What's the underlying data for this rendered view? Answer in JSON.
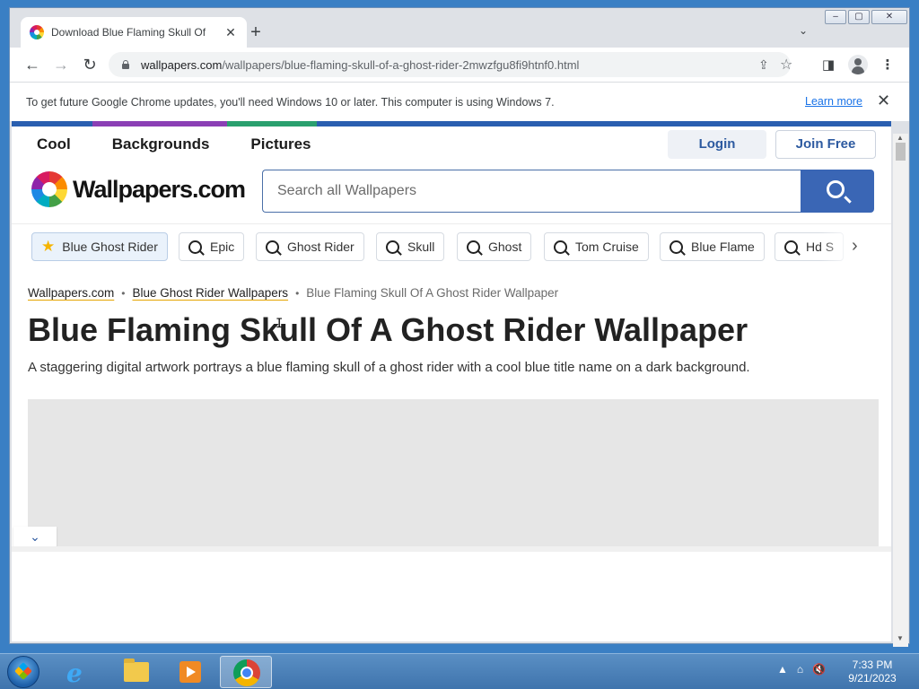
{
  "browser": {
    "tab_title": "Download Blue Flaming Skull Of",
    "tab_close": "✕",
    "new_tab": "+",
    "tab_search": "⌄",
    "window_controls": {
      "minimize": "–",
      "maximize": "▢",
      "close": "✕"
    },
    "nav": {
      "back": "←",
      "forward": "→",
      "reload": "↻"
    },
    "url_domain": "wallpapers.com",
    "url_path": "/wallpapers/blue-flaming-skull-of-a-ghost-rider-2mwzfgu8fi9htnf0.html",
    "share_icon": "⇪",
    "bookmark_icon": "☆",
    "sidepanel_icon": "◨",
    "menu_icon": "⋮"
  },
  "infobar": {
    "message": "To get future Google Chrome updates, you'll need Windows 10 or later. This computer is using Windows 7.",
    "link": "Learn more",
    "close": "✕"
  },
  "site": {
    "nav": [
      "Cool",
      "Backgrounds",
      "Pictures"
    ],
    "login": "Login",
    "join": "Join Free",
    "logo_text": "Wallpapers.com",
    "search_placeholder": "Search all Wallpapers",
    "chips": [
      {
        "label": "Blue Ghost Rider",
        "icon": "star-icon",
        "active": true
      },
      {
        "label": "Epic",
        "icon": "search-icon"
      },
      {
        "label": "Ghost Rider",
        "icon": "search-icon"
      },
      {
        "label": "Skull",
        "icon": "search-icon"
      },
      {
        "label": "Ghost",
        "icon": "search-icon"
      },
      {
        "label": "Tom Cruise",
        "icon": "search-icon"
      },
      {
        "label": "Blue Flame",
        "icon": "search-icon"
      },
      {
        "label": "Hd S",
        "icon": "search-icon"
      }
    ],
    "chip_next": "›",
    "breadcrumb": {
      "home": "Wallpapers.com",
      "category": "Blue Ghost Rider Wallpapers",
      "current": "Blue Flaming Skull Of A Ghost Rider Wallpaper",
      "separator": "•"
    },
    "title": "Blue Flaming Skull Of A Ghost Rider Wallpaper",
    "description": "A staggering digital artwork portrays a blue flaming skull of a ghost rider with a cool blue title name on a dark background.",
    "collapse": "⌄"
  },
  "taskbar": {
    "tray_icons": [
      "▲",
      "⌂",
      "🔇"
    ],
    "time": "7:33 PM",
    "date": "9/21/2023"
  },
  "colors": {
    "accent_blue": "#3a66b5",
    "link_blue": "#1a73e8",
    "underline_gold": "#e5a400"
  }
}
